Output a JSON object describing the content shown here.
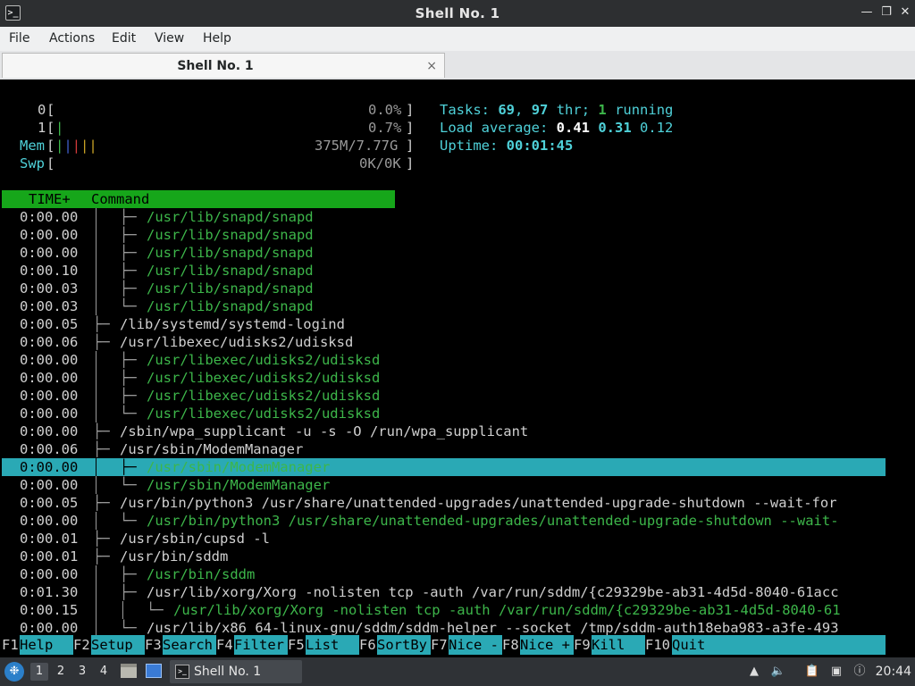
{
  "window": {
    "title": "Shell No. 1"
  },
  "menubar": {
    "items": [
      "File",
      "Actions",
      "Edit",
      "View",
      "Help"
    ]
  },
  "tab": {
    "label": "Shell No. 1",
    "close_glyph": "×"
  },
  "meters": {
    "cpu0": {
      "label": "0",
      "value": "0.0%",
      "fraction": 0.0
    },
    "cpu1": {
      "label": "1",
      "value": "0.7%",
      "fraction": 0.007
    },
    "mem": {
      "label": "Mem",
      "value": "375M/7.77G"
    },
    "swp": {
      "label": "Swp",
      "value": "0K/0K"
    }
  },
  "stats": {
    "tasks_label": "Tasks:",
    "tasks": "69",
    "thr": "97",
    "thr_label": "thr;",
    "running": "1",
    "running_label": "running",
    "load_label": "Load average:",
    "load1": "0.41",
    "load5": "0.31",
    "load15": "0.12",
    "uptime_label": "Uptime:",
    "uptime": "00:01:45"
  },
  "table": {
    "headers": {
      "time": "TIME+",
      "command": "Command"
    },
    "rows": [
      {
        "time": "0:00.00",
        "depth": 1,
        "prefix": "├─",
        "cmd": "/usr/lib/snapd/snapd",
        "thread": true
      },
      {
        "time": "0:00.00",
        "depth": 1,
        "prefix": "├─",
        "cmd": "/usr/lib/snapd/snapd",
        "thread": true
      },
      {
        "time": "0:00.00",
        "depth": 1,
        "prefix": "├─",
        "cmd": "/usr/lib/snapd/snapd",
        "thread": true
      },
      {
        "time": "0:00.10",
        "depth": 1,
        "prefix": "├─",
        "cmd": "/usr/lib/snapd/snapd",
        "thread": true
      },
      {
        "time": "0:00.03",
        "depth": 1,
        "prefix": "├─",
        "cmd": "/usr/lib/snapd/snapd",
        "thread": true
      },
      {
        "time": "0:00.03",
        "depth": 1,
        "prefix": "└─",
        "cmd": "/usr/lib/snapd/snapd",
        "thread": true
      },
      {
        "time": "0:00.05",
        "depth": 0,
        "prefix": "├─",
        "cmd": "/lib/systemd/systemd-logind",
        "thread": false
      },
      {
        "time": "0:00.06",
        "depth": 0,
        "prefix": "├─",
        "cmd": "/usr/libexec/udisks2/udisksd",
        "thread": false
      },
      {
        "time": "0:00.00",
        "depth": 1,
        "prefix": "├─",
        "cmd": "/usr/libexec/udisks2/udisksd",
        "thread": true
      },
      {
        "time": "0:00.00",
        "depth": 1,
        "prefix": "├─",
        "cmd": "/usr/libexec/udisks2/udisksd",
        "thread": true
      },
      {
        "time": "0:00.00",
        "depth": 1,
        "prefix": "├─",
        "cmd": "/usr/libexec/udisks2/udisksd",
        "thread": true
      },
      {
        "time": "0:00.00",
        "depth": 1,
        "prefix": "└─",
        "cmd": "/usr/libexec/udisks2/udisksd",
        "thread": true
      },
      {
        "time": "0:00.00",
        "depth": 0,
        "prefix": "├─",
        "cmd": "/sbin/wpa_supplicant -u -s -O /run/wpa_supplicant",
        "thread": false
      },
      {
        "time": "0:00.06",
        "depth": 0,
        "prefix": "├─",
        "cmd": "/usr/sbin/ModemManager",
        "thread": false
      },
      {
        "time": "0:00.00",
        "depth": 1,
        "prefix": "├─",
        "cmd": "/usr/sbin/ModemManager",
        "thread": true,
        "selected": true
      },
      {
        "time": "0:00.00",
        "depth": 1,
        "prefix": "└─",
        "cmd": "/usr/sbin/ModemManager",
        "thread": true
      },
      {
        "time": "0:00.05",
        "depth": 0,
        "prefix": "├─",
        "cmd": "/usr/bin/python3 /usr/share/unattended-upgrades/unattended-upgrade-shutdown --wait-for",
        "thread": false
      },
      {
        "time": "0:00.00",
        "depth": 1,
        "prefix": "└─",
        "cmd": "/usr/bin/python3 /usr/share/unattended-upgrades/unattended-upgrade-shutdown --wait-",
        "thread": true
      },
      {
        "time": "0:00.01",
        "depth": 0,
        "prefix": "├─",
        "cmd": "/usr/sbin/cupsd -l",
        "thread": false
      },
      {
        "time": "0:00.01",
        "depth": 0,
        "prefix": "├─",
        "cmd": "/usr/bin/sddm",
        "thread": false
      },
      {
        "time": "0:00.00",
        "depth": 1,
        "prefix": "├─",
        "cmd": "/usr/bin/sddm",
        "thread": true
      },
      {
        "time": "0:01.30",
        "depth": 1,
        "prefix": "├─",
        "cmd": "/usr/lib/xorg/Xorg -nolisten tcp -auth /var/run/sddm/{c29329be-ab31-4d5d-8040-61acc",
        "thread": false
      },
      {
        "time": "0:00.15",
        "depth": 2,
        "prefix": "└─",
        "cmd": "/usr/lib/xorg/Xorg -nolisten tcp -auth /var/run/sddm/{c29329be-ab31-4d5d-8040-61",
        "thread": true
      },
      {
        "time": "0:00.00",
        "depth": 1,
        "prefix": "└─",
        "cmd": "/usr/lib/x86_64-linux-gnu/sddm/sddm-helper --socket /tmp/sddm-auth18eba983-a3fe-493",
        "thread": false
      }
    ]
  },
  "fkeys": [
    {
      "num": "F1",
      "label": "Help"
    },
    {
      "num": "F2",
      "label": "Setup"
    },
    {
      "num": "F3",
      "label": "Search"
    },
    {
      "num": "F4",
      "label": "Filter"
    },
    {
      "num": "F5",
      "label": "List"
    },
    {
      "num": "F6",
      "label": "SortBy"
    },
    {
      "num": "F7",
      "label": "Nice -"
    },
    {
      "num": "F8",
      "label": "Nice +"
    },
    {
      "num": "F9",
      "label": "Kill"
    },
    {
      "num": "F10",
      "label": "Quit"
    }
  ],
  "taskbar": {
    "desktops": [
      "1",
      "2",
      "3",
      "4"
    ],
    "active_desktop": "1",
    "task_label": "Shell No. 1",
    "clock": "20:44"
  },
  "colors": {
    "header_green": "#16a61a",
    "selection_cyan": "#2aa9b5",
    "thread_green": "#3db64a",
    "stats_cyan": "#4fd1d9"
  }
}
